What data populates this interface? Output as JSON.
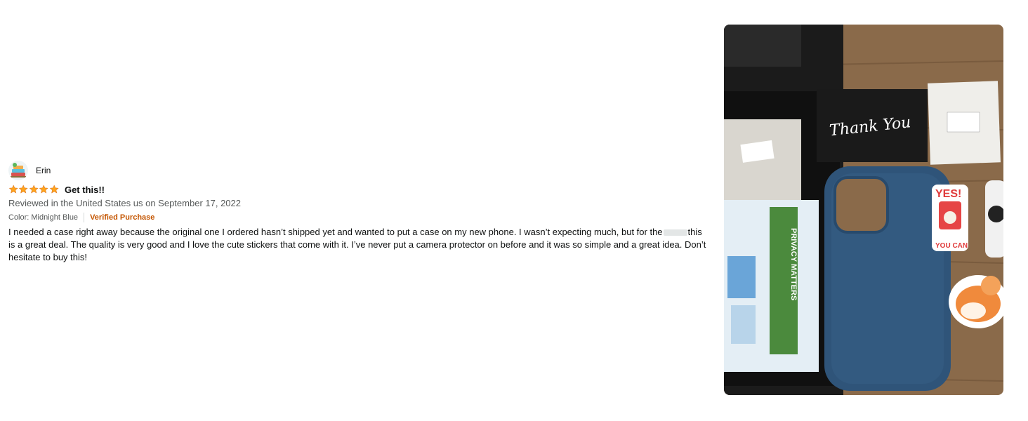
{
  "review": {
    "reviewer_name": "Erin",
    "rating": 5,
    "rating_max": 5,
    "star_color": "#ffa41c",
    "title": "Get this!!",
    "date_text": "Reviewed in the United States us on September 17, 2022",
    "variant": "Color: Midnight Blue",
    "verified_label": "Verified Purchase",
    "verified_color": "#c45500",
    "body_part1": "I needed a case right away because the original one I ordered hasn’t shipped yet and wanted to put a case on my new phone. I wasn’t expecting much, but for the",
    "body_part2": "this is a great deal. The quality is very good and I love the cute stickers that come with it. I’ve never put a camera protector on before and it was so simple and a great idea. Don’t hesitate to buy this!"
  },
  "photo": {
    "card_text": "Thank You",
    "privacy_text": "PRIVACY MATTERS",
    "sticker_yes": "YES!",
    "sticker_you_can": "YOU CAN",
    "case_color": "#2f5479"
  }
}
